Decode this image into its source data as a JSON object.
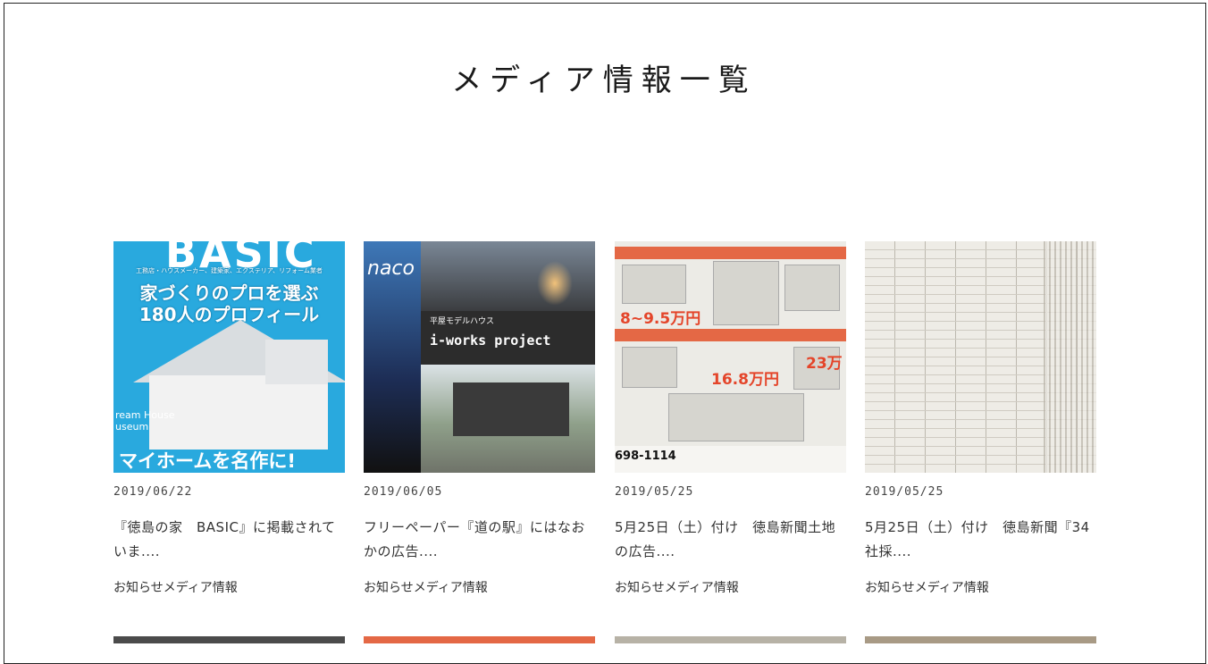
{
  "page": {
    "title": "メディア情報一覧"
  },
  "posts": [
    {
      "date": "2019/06/22",
      "title": "『徳島の家　BASIC』に掲載されていま....",
      "categories": [
        "お知らせ",
        "メディア情報"
      ],
      "thumb": {
        "big": "BASIC",
        "line1": "工務店・ハウスメーカー、建築家、エクステリア、リフォーム業者",
        "line2": "家づくりのプロを選ぶ",
        "line3": "180人のプロフィール",
        "side": "ream House\nuseum",
        "bottom": "マイホームを名作に!"
      }
    },
    {
      "date": "2019/06/05",
      "title": "フリーペーパー『道の駅』にはなおかの広告....",
      "categories": [
        "お知らせ",
        "メディア情報"
      ],
      "thumb": {
        "logo": "naco",
        "band": "平屋モデルハウス",
        "project": "i-works project"
      }
    },
    {
      "date": "2019/05/25",
      "title": "5月25日（土）付け　徳島新聞土地の広告....",
      "categories": [
        "お知らせ",
        "メディア情報"
      ],
      "thumb": {
        "price1": "8~9.5万円",
        "price2": "16.8万円",
        "price3": "23万",
        "tel": "698-1114"
      }
    },
    {
      "date": "2019/05/25",
      "title": "5月25日（土）付け　徳島新聞『34社採....",
      "categories": [
        "お知らせ",
        "メディア情報"
      ],
      "thumb": {}
    }
  ],
  "colors": {
    "accent_blue": "#29a9de",
    "ad_orange": "#e46845"
  }
}
